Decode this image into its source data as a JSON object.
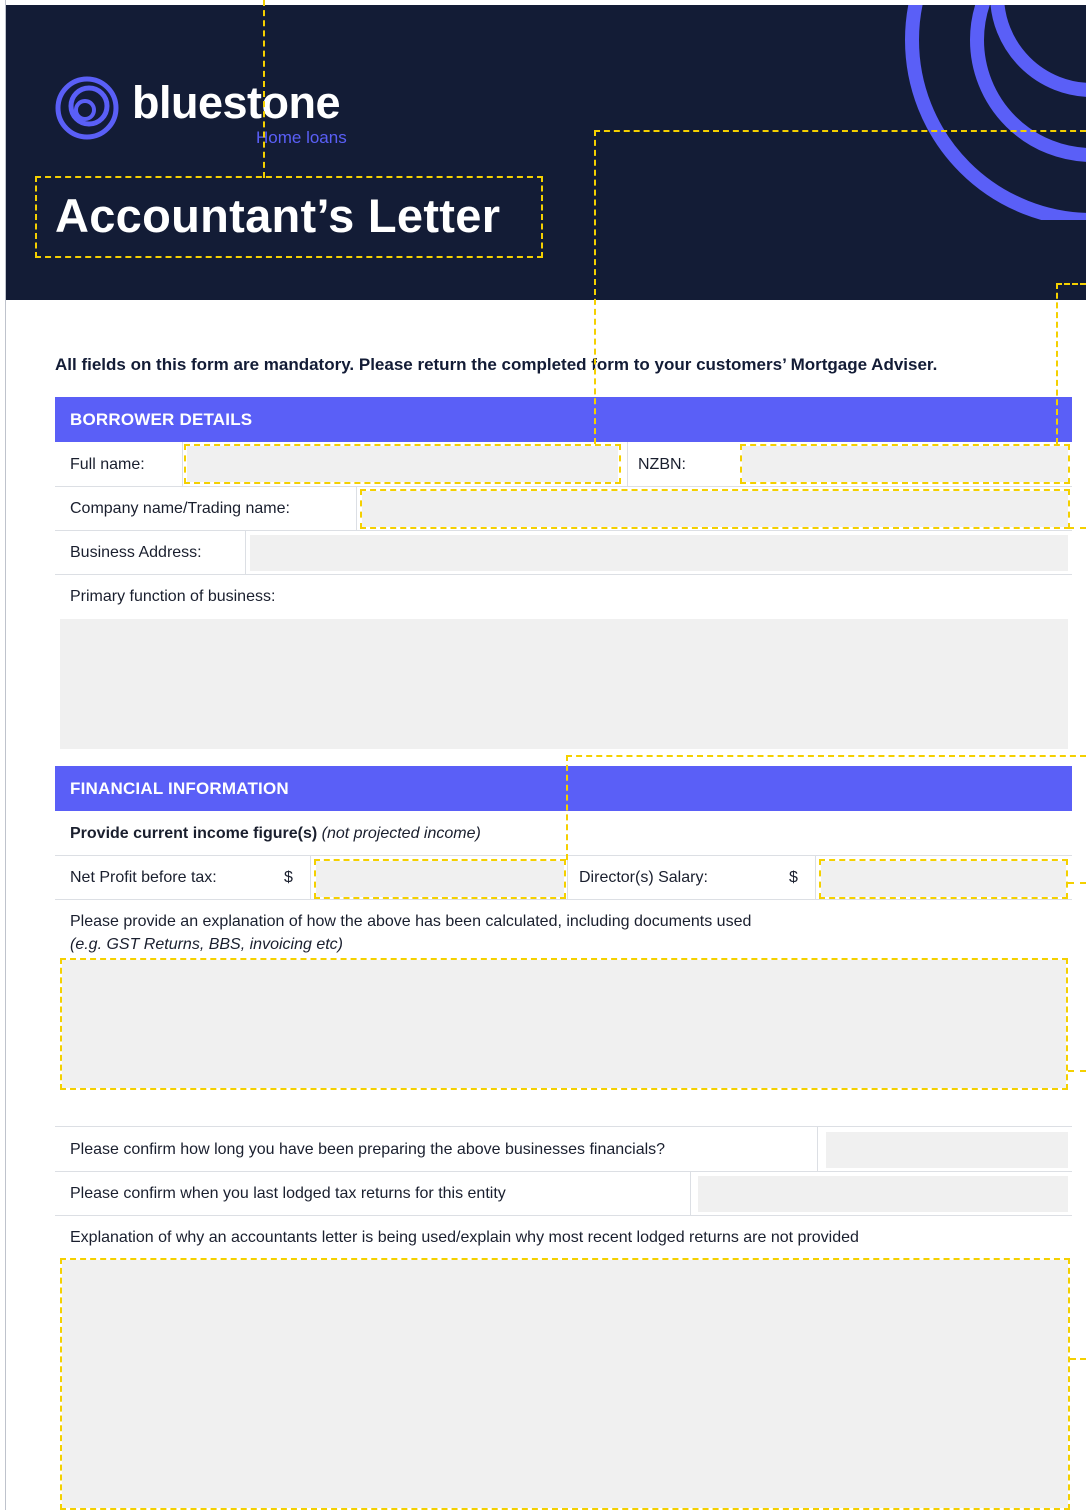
{
  "brand": {
    "name": "bluestone",
    "tagline": "Home loans",
    "colors": {
      "navy": "#131c36",
      "accent": "#5a5ff7",
      "field": "#f0f0f0",
      "guide": "#f4d000"
    }
  },
  "document": {
    "title": "Accountant’s Letter",
    "intro": "All fields on this form are mandatory. Please return the completed form to your customers’ Mortgage Adviser."
  },
  "borrower": {
    "heading": "BORROWER DETAILS",
    "full_name_label": "Full name:",
    "nzbn_label": "NZBN:",
    "company_label": "Company name/Trading name:",
    "address_label": "Business Address:",
    "function_label": "Primary function of business:"
  },
  "financial": {
    "heading": "FINANCIAL INFORMATION",
    "income_bold": "Provide current income figure(s)",
    "income_italic": "(not projected income)",
    "net_profit_label": "Net Profit before tax:",
    "currency": "$",
    "director_label": "Director(s) Salary:",
    "explain_line1": "Please provide an explanation of how the above has been calculated, including documents used",
    "explain_line2": "(e.g. GST Returns, BBS, invoicing etc)",
    "how_long_label": "Please confirm how long you have been preparing the above businesses financials?",
    "last_lodged_label": "Please confirm when you last lodged tax returns for this entity",
    "why_label": "Explanation of why an accountants letter is being used/explain why most recent lodged returns are not provided"
  }
}
